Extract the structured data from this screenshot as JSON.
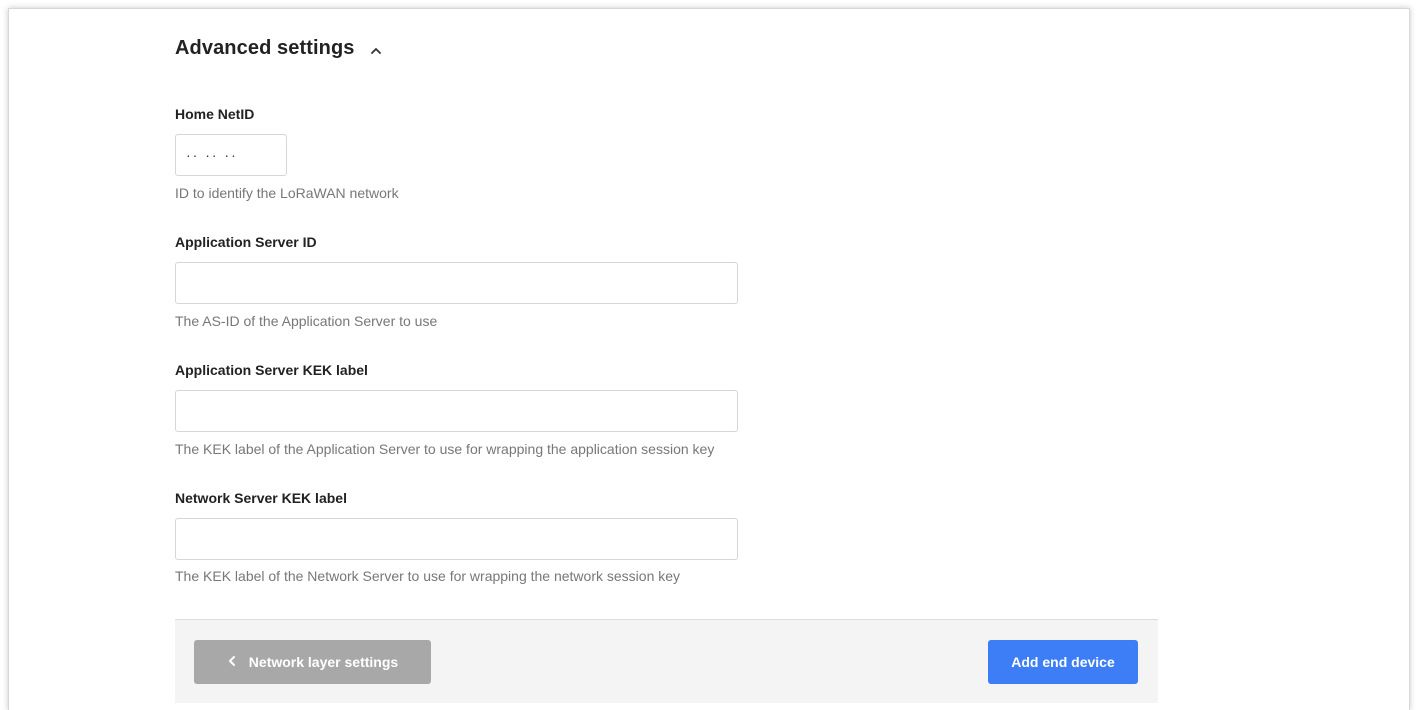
{
  "section": {
    "title": "Advanced settings"
  },
  "fields": {
    "home_netid": {
      "label": "Home NetID",
      "value": "·· ·· ··",
      "description": "ID to identify the LoRaWAN network"
    },
    "as_id": {
      "label": "Application Server ID",
      "value": "",
      "description": "The AS-ID of the Application Server to use"
    },
    "as_kek": {
      "label": "Application Server KEK label",
      "value": "",
      "description": "The KEK label of the Application Server to use for wrapping the application session key"
    },
    "ns_kek": {
      "label": "Network Server KEK label",
      "value": "",
      "description": "The KEK label of the Network Server to use for wrapping the network session key"
    }
  },
  "footer": {
    "back_label": "Network layer settings",
    "submit_label": "Add end device"
  },
  "icons": {
    "collapse": "chevron-up-icon",
    "back": "chevron-left-icon"
  },
  "colors": {
    "primary": "#3d7ef7",
    "disabled": "#a8a8a8"
  }
}
